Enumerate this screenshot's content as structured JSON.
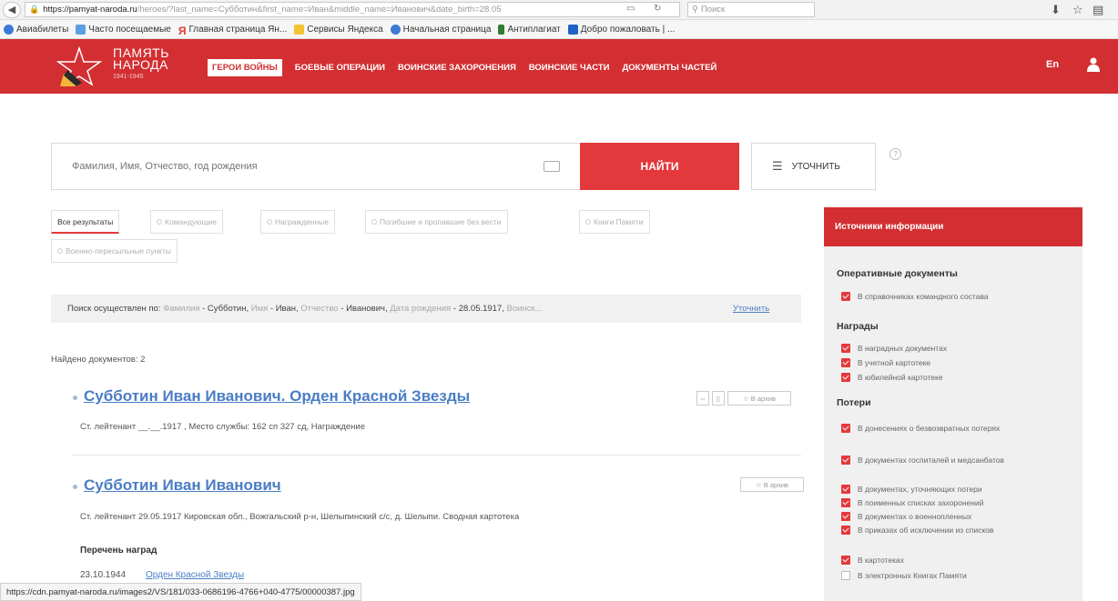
{
  "browser": {
    "url_host": "https://pamyat-naroda.ru",
    "url_rest": "/heroes/?last_name=Субботин&first_name=Иван&middle_name=Иванович&date_birth=28.05",
    "search_placeholder": "Поиск",
    "bookmarks": [
      {
        "label": "Авиабилеты",
        "color": "#3a7bd5"
      },
      {
        "label": "Часто посещаемые",
        "color": "#5aa0e0"
      },
      {
        "label": "Главная страница Ян...",
        "color": "#e53935"
      },
      {
        "label": "Сервисы Яндекса",
        "color": "#f2c230"
      },
      {
        "label": "Начальная страница",
        "color": "#3a7bd5"
      },
      {
        "label": "Антиплагиат",
        "color": "#2e7d32"
      },
      {
        "label": "Добро пожаловать | ...",
        "color": "#1e63c6"
      }
    ]
  },
  "header": {
    "logo_line1": "ПАМЯТЬ",
    "logo_line2": "НАРОДА",
    "logo_years": "1941-1945",
    "nav": [
      "ГЕРОИ ВОЙНЫ",
      "БОЕВЫЕ ОПЕРАЦИИ",
      "ВОИНСКИЕ ЗАХОРОНЕНИЯ",
      "ВОИНСКИЕ ЧАСТИ",
      "ДОКУМЕНТЫ ЧАСТЕЙ"
    ],
    "lang": "En"
  },
  "search": {
    "placeholder": "Фамилия, Имя, Отчество, год рождения",
    "find_label": "НАЙТИ",
    "refine_label": "УТОЧНИТЬ",
    "help": "?"
  },
  "tabs": [
    "Все результаты",
    "Командующие",
    "Награжденные",
    "Погибшие и пропавшие без вести",
    "Книги Памяти",
    "Военно-пересыльные пункты"
  ],
  "query": {
    "prefix": "Поиск осуществлен по:",
    "k1": "Фамилия",
    "v1": "Субботин,",
    "k2": "Имя",
    "v2": "Иван,",
    "k3": "Отчество",
    "v3": "Иванович,",
    "k4": "Дата рождения",
    "v4": "28.05.1917,",
    "k5": "Воинск...",
    "refine": "Уточнить"
  },
  "found": "Найдено документов: 2",
  "results": [
    {
      "title": "Субботин Иван Иванович. Орден Красной Звезды",
      "meta": "Ст. лейтенант __.__.1917 , Место службы: 162 сп 327 сд, Награждение",
      "archive": "☆ В архив"
    },
    {
      "title": "Субботин Иван Иванович",
      "meta": "Ст. лейтенант 29.05.1917 Кировская обл., Вожгальский р-н, Шелыпинский с/с, д. Шелыпи. Сводная картотека",
      "archive": "☆ В архив"
    }
  ],
  "awards": {
    "heading": "Перечень наград",
    "date": "23.10.1944",
    "link": "Орден Красной Звезды"
  },
  "status_url": "https://cdn.pamyat-naroda.ru/images2/VS/181/033-0686196-4766+040-4775/00000387.jpg",
  "sidebar": {
    "title": "Источники информации",
    "sections": [
      {
        "title": "Оперативные документы",
        "items": [
          "В справочниках командного состава"
        ]
      },
      {
        "title": "Награды",
        "items": [
          "В наградных документах",
          "В учетной картотеке",
          "В юбилейной картотеке"
        ]
      },
      {
        "title": "Потери",
        "items": [
          "В донесениях о безвозвратных потерях",
          "В документах госпиталей и медсанбатов",
          "В документах, уточняющих потери",
          "В поименных списках захоронений",
          "В документах о военнопленных",
          "В приказах об исключении из списков",
          "В картотеках"
        ]
      }
    ],
    "unchecked": "В электронных Книгах Памяти"
  },
  "colors": {
    "brand_red": "#d32f32",
    "button_red": "#e4393c",
    "link_blue": "#4a7dc4"
  }
}
